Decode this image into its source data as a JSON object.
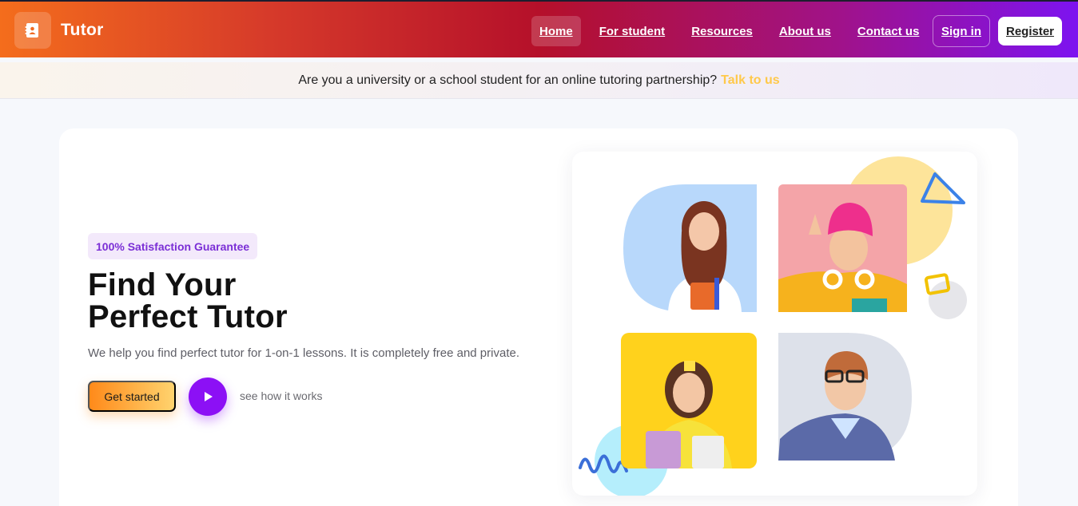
{
  "brand": {
    "name": "Tutor",
    "icon": "contact-book-icon"
  },
  "nav": {
    "links": [
      {
        "label": "Home",
        "active": true
      },
      {
        "label": "For student",
        "active": false
      },
      {
        "label": "Resources",
        "active": false
      },
      {
        "label": "About us",
        "active": false
      },
      {
        "label": "Contact us",
        "active": false
      }
    ],
    "signin_label": "Sign in",
    "register_label": "Register"
  },
  "announcement": {
    "text": "Are you a university or a school student for an online tutoring partnership?",
    "link_label": "Talk to us"
  },
  "hero": {
    "badge": "100% Satisfaction Guarantee",
    "title_line1": "Find Your",
    "title_line2": "Perfect Tutor",
    "subtitle": "We help you find perfect tutor for 1-on-1 lessons. It is completely free and private.",
    "cta_label": "Get started",
    "play_icon": "play-icon",
    "see_how_label": "see how it works"
  },
  "colors": {
    "accent_orange": "#ff8a1a",
    "accent_purple": "#8c10f5",
    "link_yellow": "#ffc94a",
    "badge_text": "#7b2fd6"
  }
}
